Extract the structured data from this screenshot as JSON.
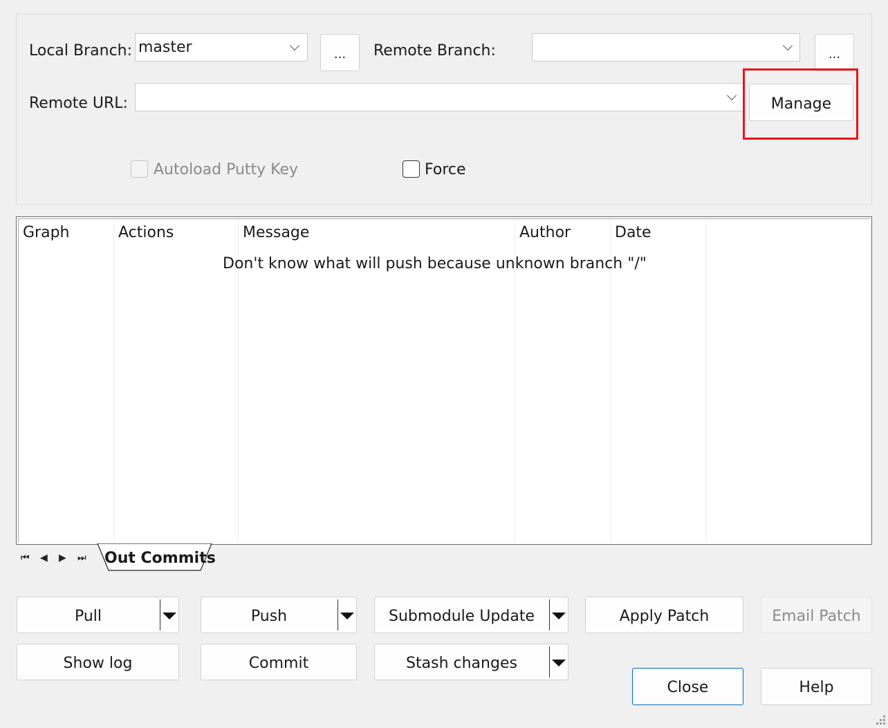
{
  "form": {
    "local_branch_label": "Local Branch:",
    "local_branch_value": "master",
    "local_browse_label": "...",
    "remote_branch_label": "Remote Branch:",
    "remote_branch_value": "",
    "remote_browse_label": "...",
    "remote_url_label": "Remote URL:",
    "remote_url_value": "",
    "manage_label": "Manage",
    "autoload_label": "Autoload Putty Key",
    "force_label": "Force"
  },
  "grid": {
    "columns": [
      "Graph",
      "Actions",
      "Message",
      "Author",
      "Date"
    ],
    "empty_message": "Don't know what will push because unknown branch \"/\""
  },
  "tabs": {
    "active_label": "Out Commits"
  },
  "buttons": {
    "pull": "Pull",
    "push": "Push",
    "submodule_update": "Submodule Update",
    "apply_patch": "Apply Patch",
    "email_patch": "Email Patch",
    "show_log": "Show log",
    "commit": "Commit",
    "stash_changes": "Stash changes",
    "close": "Close",
    "help": "Help"
  },
  "colors": {
    "highlight": "#e8131c",
    "default_button_border": "#0067c0"
  }
}
